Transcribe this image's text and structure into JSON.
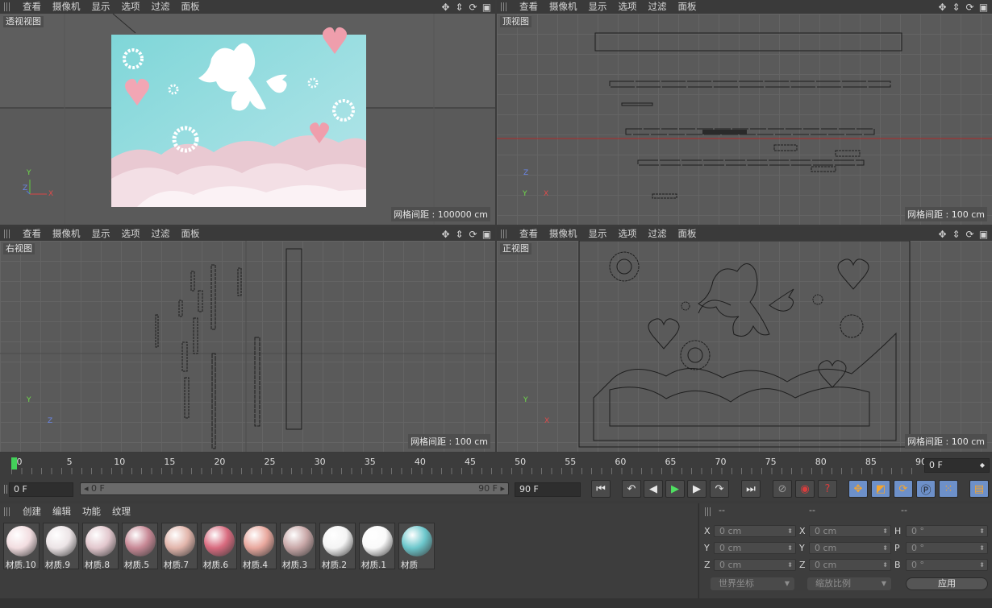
{
  "viewports": {
    "menu": [
      "查看",
      "摄像机",
      "显示",
      "选项",
      "过滤",
      "面板"
    ],
    "perspective": {
      "label": "透视视图",
      "grid": "网格间距 : 100000 cm"
    },
    "top": {
      "label": "顶视图",
      "grid": "网格间距 : 100 cm"
    },
    "right": {
      "label": "右视图",
      "grid": "网格间距 : 100 cm"
    },
    "front": {
      "label": "正视图",
      "grid": "网格间距 : 100 cm"
    },
    "axes": {
      "x": "X",
      "y": "Y",
      "z": "Z"
    }
  },
  "timeline": {
    "ticks": [
      "0",
      "5",
      "10",
      "15",
      "20",
      "25",
      "30",
      "35",
      "40",
      "45",
      "50",
      "55",
      "60",
      "65",
      "70",
      "75",
      "80",
      "85",
      "90"
    ],
    "current_frame": "0 F",
    "start_field": "0 F",
    "range_start": "0 F",
    "range_end": "90 F",
    "end_field": "90 F"
  },
  "materials": {
    "menu": [
      "创建",
      "编辑",
      "功能",
      "纹理"
    ],
    "items": [
      {
        "name": "材质.10",
        "color": "#f2dde0"
      },
      {
        "name": "材质.9",
        "color": "#ece4e6"
      },
      {
        "name": "材质.8",
        "color": "#e2c7cd"
      },
      {
        "name": "材质.5",
        "color": "#c78895"
      },
      {
        "name": "材质.7",
        "color": "#e2b5ab"
      },
      {
        "name": "材质.6",
        "color": "#d86a7e"
      },
      {
        "name": "材质.4",
        "color": "#e8a79d"
      },
      {
        "name": "材质.3",
        "color": "#c8a7a7"
      },
      {
        "name": "材质.2",
        "color": "#f4f4f4"
      },
      {
        "name": "材质.1",
        "color": "#fafafa"
      },
      {
        "name": "材质",
        "color": "#6cc7cc"
      }
    ]
  },
  "attributes": {
    "headers": [
      "--",
      "--",
      "--"
    ],
    "position": [
      {
        "axis": "X",
        "value": "0 cm"
      },
      {
        "axis": "Y",
        "value": "0 cm"
      },
      {
        "axis": "Z",
        "value": "0 cm"
      }
    ],
    "size": [
      {
        "axis": "X",
        "value": "0 cm"
      },
      {
        "axis": "Y",
        "value": "0 cm"
      },
      {
        "axis": "Z",
        "value": "0 cm"
      }
    ],
    "rotation": [
      {
        "axis": "H",
        "value": "0 °"
      },
      {
        "axis": "P",
        "value": "0 °"
      },
      {
        "axis": "B",
        "value": "0 °"
      }
    ],
    "coord_mode": "世界坐标",
    "scale_mode": "缩放比例",
    "apply": "应用"
  }
}
